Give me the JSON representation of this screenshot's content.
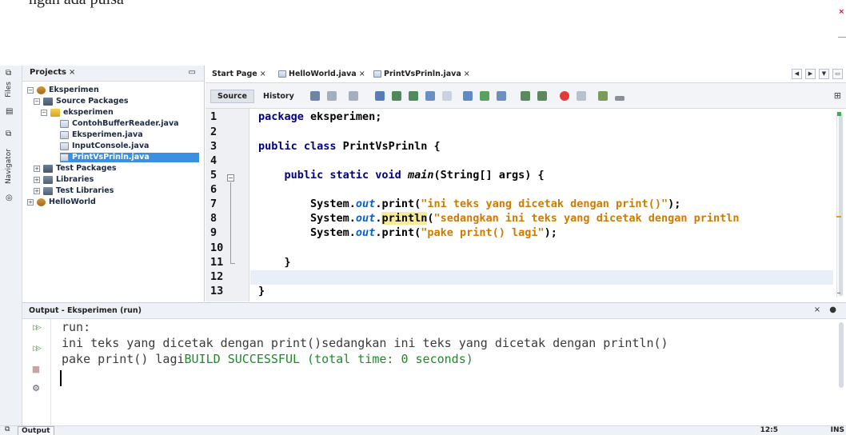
{
  "caption_fragment": "ngan   ada pulsa",
  "left_strip": {
    "files_tab": "Files",
    "navigator_tab": "Navigator"
  },
  "projects_panel": {
    "tab_label": "Projects",
    "close_glyph": "×",
    "minimize_glyph": "▭",
    "tree": [
      {
        "label": "Eksperimen",
        "expander": "−",
        "icon": "project-icon"
      },
      {
        "label": "Source Packages",
        "expander": "−",
        "icon": "source-packages-icon"
      },
      {
        "label": "eksperimen",
        "expander": "−",
        "icon": "package-icon"
      },
      {
        "label": "ContohBufferReader.java",
        "icon": "java-file-icon"
      },
      {
        "label": "Eksperimen.java",
        "icon": "java-file-icon"
      },
      {
        "label": "InputConsole.java",
        "icon": "java-file-icon"
      },
      {
        "label": "PrintVsPrinln.java",
        "icon": "java-file-icon",
        "selected": true
      },
      {
        "label": "Test Packages",
        "expander": "+",
        "icon": "test-packages-icon"
      },
      {
        "label": "Libraries",
        "expander": "+",
        "icon": "libraries-icon"
      },
      {
        "label": "Test Libraries",
        "expander": "+",
        "icon": "libraries-icon"
      },
      {
        "label": "HelloWorld",
        "expander": "+",
        "icon": "project-icon"
      }
    ]
  },
  "editor_tabs": [
    {
      "label": "Start Page"
    },
    {
      "label": "HelloWorld.java"
    },
    {
      "label": "PrintVsPrinln.java",
      "active": true
    }
  ],
  "tab_close_glyph": "×",
  "nav_buttons": [
    "◀",
    "▶",
    "▼",
    "▭"
  ],
  "toolbar": {
    "source_label": "Source",
    "history_label": "History",
    "extra_glyph": "⊞"
  },
  "editor": {
    "line_numbers": [
      "1",
      "2",
      "3",
      "4",
      "5",
      "6",
      "7",
      "8",
      "9",
      "10",
      "11",
      "12",
      "13"
    ],
    "fold_open": "−",
    "code": {
      "l1_kw": "package",
      "l1_rest": " eksperimen;",
      "l3_kw": "public class",
      "l3_rest": " PrintVsPrinln {",
      "l5_kw": "    public static void",
      "l5_method": "main",
      "l5_rest": "(String[] args) {",
      "sys": "        System.",
      "out": "out",
      "print": ".print(",
      "println": "println",
      "dot": ".",
      "paren": "(",
      "l7_str": "\"ini teks yang dicetak dengan print()\"",
      "l8_str": "\"sedangkan ini teks yang dicetak dengan println",
      "l9_str": "\"pake print() lagi\"",
      "close_stmt": ");",
      "l11": "    }",
      "l13": "}"
    }
  },
  "output": {
    "title": "Output - Eksperimen (run)",
    "controls": "× ●",
    "buttons": [
      "▷▷",
      "▷▷",
      "■",
      "⚙"
    ],
    "line1": "run:",
    "line2": "ini teks yang dicetak dengan print()sedangkan ini teks yang dicetak dengan println()",
    "line3_plain": "pake print() lagi",
    "line3_ok": "BUILD SUCCESSFUL (total time: 0 seconds)"
  },
  "status_bar": {
    "output_tab": "Output",
    "position": "12:5",
    "mode": "INS"
  }
}
